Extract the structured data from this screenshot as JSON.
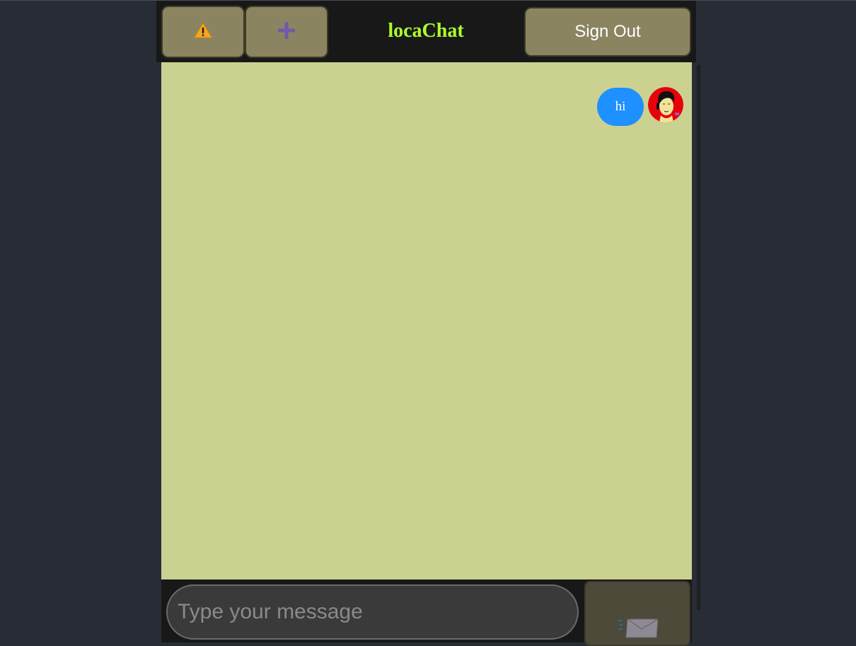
{
  "app": {
    "title": "locaChat"
  },
  "header": {
    "warning_icon": "warning-icon",
    "add_icon": "plus-icon",
    "sign_out_label": "Sign Out"
  },
  "messages": [
    {
      "text": "hi",
      "own": true,
      "avatar": "user-avatar"
    }
  ],
  "composer": {
    "placeholder": "Type your message",
    "value": "",
    "send_icon": "send-mail-icon"
  },
  "colors": {
    "background": "#282c34",
    "header": "#181818",
    "chat_area": "#cbd190",
    "button": "#8b8460",
    "title": "#adff2f",
    "bubble": "#1e90ff",
    "send_button": "#4e4a3a"
  }
}
